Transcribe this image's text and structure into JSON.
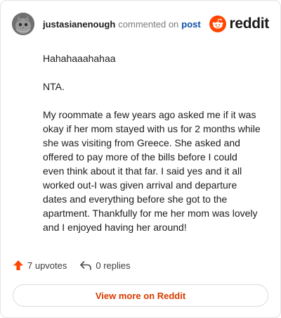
{
  "header": {
    "username": "justasianenough",
    "action_text": "commented on",
    "post_link": "post",
    "brand": "reddit"
  },
  "comment": {
    "paragraphs": [
      "Hahahaaahahaa",
      "NTA.",
      "My roommate a few years ago asked me if it was okay if her mom stayed with us for 2 months while she was visiting from Greece. She asked and offered to pay more of the bills before I could even think about it that far. I said yes and it all worked out-I was given arrival and departure dates and everything before she got to the apartment. Thankfully for me her mom was lovely and I enjoyed having her around!"
    ]
  },
  "footer": {
    "upvotes": "7 upvotes",
    "replies": "0 replies"
  },
  "cta": {
    "label": "View more on Reddit"
  },
  "colors": {
    "brand_orange": "#ff4500",
    "link_blue": "#0a4fa8",
    "cta_text": "#d93a00"
  }
}
